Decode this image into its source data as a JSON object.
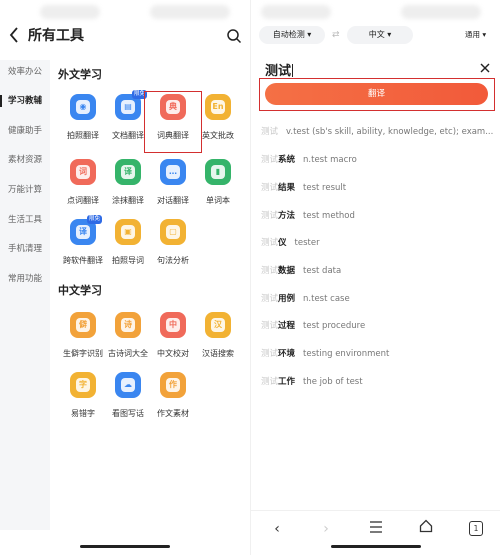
{
  "left": {
    "title": "所有工具",
    "sidebar": [
      "效率办公",
      "学习教辅",
      "健康助手",
      "素材资源",
      "万能计算",
      "生活工具",
      "手机清理",
      "常用功能"
    ],
    "sections": [
      {
        "title": "外文学习",
        "tools": [
          {
            "label": "拍照翻译",
            "color": "#3a86f0",
            "glyph": "◉",
            "icon": "camera-icon",
            "badge": ""
          },
          {
            "label": "文档翻译",
            "color": "#3a86f0",
            "glyph": "▤",
            "icon": "document-icon",
            "badge": "限免"
          },
          {
            "label": "词典翻译",
            "color": "#f06a5a",
            "glyph": "典",
            "icon": "dictionary-icon",
            "badge": ""
          },
          {
            "label": "英文批改",
            "color": "#f2b233",
            "glyph": "En",
            "icon": "english-check-icon",
            "badge": ""
          },
          {
            "label": "点词翻译",
            "color": "#f06a5a",
            "glyph": "词",
            "icon": "word-tap-icon",
            "badge": ""
          },
          {
            "label": "涂抹翻译",
            "color": "#35b46a",
            "glyph": "译",
            "icon": "smear-icon",
            "badge": ""
          },
          {
            "label": "对话翻译",
            "color": "#3a86f0",
            "glyph": "…",
            "icon": "chat-icon",
            "badge": ""
          },
          {
            "label": "单词本",
            "color": "#35b46a",
            "glyph": "▮",
            "icon": "wordbook-icon",
            "badge": ""
          },
          {
            "label": "跨软件翻译",
            "color": "#3a86f0",
            "glyph": "译",
            "icon": "cross-app-icon",
            "badge": "限免"
          },
          {
            "label": "拍照导词",
            "color": "#f2b233",
            "glyph": "▣",
            "icon": "photo-import-icon",
            "badge": ""
          },
          {
            "label": "句法分析",
            "color": "#f2b233",
            "glyph": "▢",
            "icon": "syntax-icon",
            "badge": ""
          }
        ]
      },
      {
        "title": "中文学习",
        "tools": [
          {
            "label": "生僻字识别",
            "color": "#f2a23a",
            "glyph": "僻",
            "icon": "rare-char-icon",
            "badge": ""
          },
          {
            "label": "古诗词大全",
            "color": "#f2a23a",
            "glyph": "诗",
            "icon": "poetry-icon",
            "badge": ""
          },
          {
            "label": "中文校对",
            "color": "#f06a5a",
            "glyph": "中",
            "icon": "proofread-icon",
            "badge": ""
          },
          {
            "label": "汉语搜索",
            "color": "#f2b233",
            "glyph": "汉",
            "icon": "hanyu-search-icon",
            "badge": ""
          },
          {
            "label": "易错字",
            "color": "#f2b233",
            "glyph": "字",
            "icon": "typo-icon",
            "badge": ""
          },
          {
            "label": "看图写话",
            "color": "#3a86f0",
            "glyph": "☁",
            "icon": "picture-writing-icon",
            "badge": ""
          },
          {
            "label": "作文素材",
            "color": "#f2a23a",
            "glyph": "作",
            "icon": "essay-icon",
            "badge": ""
          }
        ]
      }
    ]
  },
  "right": {
    "source_lang": "自动检测",
    "target_lang": "中文",
    "mode": "通用",
    "input_value": "测试",
    "translate_label": "翻译",
    "results": [
      {
        "prefix": "测试",
        "suffix": "",
        "definition": "v.test (sb's skill, ability, knowledge, etc); exam..."
      },
      {
        "prefix": "测试",
        "suffix": "系统",
        "definition": "n.test macro"
      },
      {
        "prefix": "测试",
        "suffix": "结果",
        "definition": "test result"
      },
      {
        "prefix": "测试",
        "suffix": "方法",
        "definition": "test method"
      },
      {
        "prefix": "测试",
        "suffix": "仪",
        "definition": "tester"
      },
      {
        "prefix": "测试",
        "suffix": "数据",
        "definition": "test data"
      },
      {
        "prefix": "测试",
        "suffix": "用例",
        "definition": "n.test case"
      },
      {
        "prefix": "测试",
        "suffix": "过程",
        "definition": "test procedure"
      },
      {
        "prefix": "测试",
        "suffix": "环境",
        "definition": "testing environment"
      },
      {
        "prefix": "测试",
        "suffix": "工作",
        "definition": "the job of test"
      }
    ],
    "tab_count": "1"
  }
}
